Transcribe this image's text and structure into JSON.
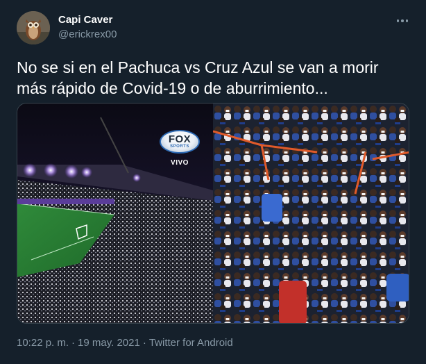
{
  "author": {
    "display_name": "Capi Caver",
    "handle": "@erickrex00",
    "avatar_icon": "owl-avatar"
  },
  "tweet": {
    "text": "No se si en el Pachuca vs Cruz Azul se van a morir más rápido de Covid-19 o de aburrimiento..."
  },
  "media": {
    "left_image": {
      "logo_word": "FOX",
      "logo_sub": "SPORTS",
      "live_label": "VIVO"
    },
    "right_image": {}
  },
  "meta": {
    "time": "10:22 p. m.",
    "date": "19 may. 2021",
    "source": "Twitter for Android",
    "separator": "·"
  },
  "colors": {
    "background": "#15202b",
    "secondary_text": "#8899a6",
    "border": "#38444d"
  }
}
